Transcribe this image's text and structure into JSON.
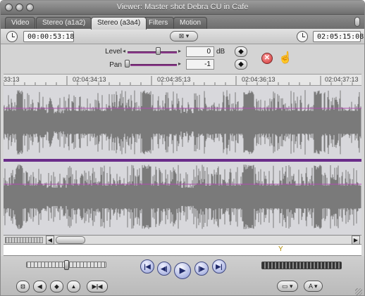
{
  "window": {
    "title": "Viewer: Master shot Debra CU in Cafe"
  },
  "tabs": [
    {
      "label": "Video",
      "active": false
    },
    {
      "label": "Stereo (a1a2)",
      "active": false
    },
    {
      "label": "Stereo (a3a4)",
      "active": true
    },
    {
      "label": "Filters",
      "active": false
    },
    {
      "label": "Motion",
      "active": false
    }
  ],
  "timecode": {
    "duration": "00:00:53:18",
    "current": "02:05:15:08",
    "marker_button": "⊠ ▾"
  },
  "audio_controls": {
    "level_label": "Level",
    "level_value": "0",
    "level_unit": "dB",
    "pan_label": "Pan",
    "pan_value": "-1",
    "keyframe_glyph": "◆",
    "reset_glyph": "✕",
    "hand_glyph": "☝"
  },
  "ruler": {
    "labels": [
      "33:13",
      "02:04:34:13",
      "02:04:35:13",
      "02:04:36:13",
      "02:04:37:13"
    ]
  },
  "scrollbar": {
    "left_arrow": "◀",
    "right_arrow": "▶"
  },
  "transport": {
    "buttons": [
      {
        "name": "go-to-in",
        "glyph": "|◀"
      },
      {
        "name": "prev-edit",
        "glyph": "◀|"
      },
      {
        "name": "play",
        "glyph": "▶"
      },
      {
        "name": "next-edit",
        "glyph": "|▶"
      },
      {
        "name": "go-to-out",
        "glyph": "▶|"
      }
    ],
    "left_buttons": [
      {
        "name": "match-frame",
        "glyph": "⊡"
      },
      {
        "name": "mark-in",
        "glyph": "◀"
      },
      {
        "name": "mark-clip",
        "glyph": "◆"
      },
      {
        "name": "add-marker",
        "glyph": "▲"
      },
      {
        "name": "mark-out",
        "glyph": "▶|◀"
      }
    ],
    "right_buttons": [
      {
        "name": "view-options",
        "glyph": "▭ ▾"
      },
      {
        "name": "generator",
        "glyph": "A ▾"
      }
    ]
  },
  "colors": {
    "waveform": "#7a7a7a",
    "level_line": "#b14ab1",
    "divider": "#6a2c8a",
    "accent": "#3f4880"
  }
}
